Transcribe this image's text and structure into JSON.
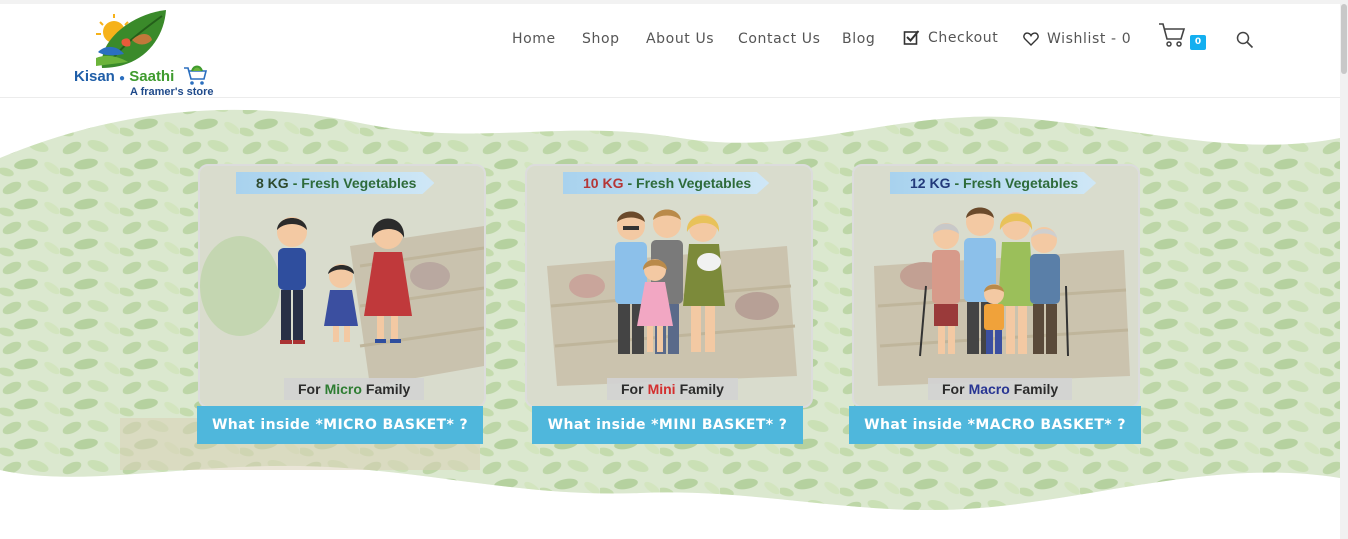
{
  "header": {
    "logo": {
      "name_part1": "Kisan",
      "name_part2": "Saathi",
      "tagline": "A framer's store",
      "icon": "leaf-sun-logo-icon"
    },
    "nav": [
      {
        "label": "Home"
      },
      {
        "label": "Shop"
      },
      {
        "label": "About Us"
      },
      {
        "label": "Contact Us"
      },
      {
        "label": "Blog"
      },
      {
        "label": "Checkout",
        "icon": "checkbox-icon"
      },
      {
        "label": "Wishlist - 0",
        "icon": "heart-icon"
      }
    ],
    "cart": {
      "count": "0",
      "icon": "cart-icon"
    },
    "search": {
      "icon": "search-icon"
    }
  },
  "baskets": [
    {
      "weight": "8 KG",
      "title_suffix": "- Fresh Vegetables",
      "family_prefix": "For",
      "family_size": "Micro",
      "family_suffix": "Family",
      "size_color": "#2e7d32",
      "weight_color": "#2e4a2e",
      "button": "What inside *MICRO BASKET* ?"
    },
    {
      "weight": "10 KG",
      "title_suffix": "- Fresh Vegetables",
      "family_prefix": "For",
      "family_size": "Mini",
      "family_suffix": "Family",
      "size_color": "#d32f2f",
      "weight_color": "#b53636",
      "button": "What inside *MINI BASKET* ?"
    },
    {
      "weight": "12 KG",
      "title_suffix": "- Fresh Vegetables",
      "family_prefix": "For",
      "family_size": "Macro",
      "family_suffix": "Family",
      "size_color": "#283593",
      "weight_color": "#233a7a",
      "button": "What inside *MACRO BASKET* ?"
    }
  ],
  "colors": {
    "accent": "#13aff0",
    "button": "#4fb7dc",
    "nav_text": "#555555"
  }
}
